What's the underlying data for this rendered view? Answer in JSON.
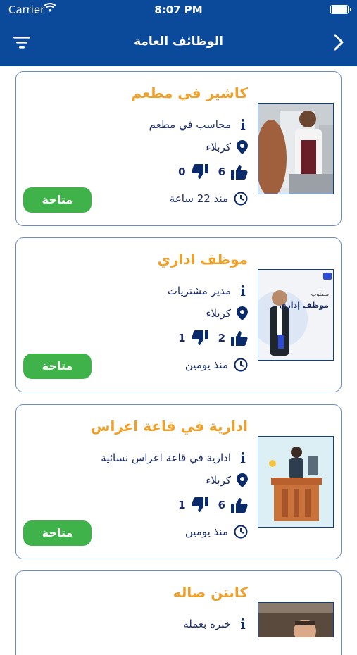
{
  "status_bar": {
    "carrier": "Carrier",
    "time": "8:07 PM"
  },
  "header": {
    "title": "الوظائف العامة"
  },
  "jobs": [
    {
      "title": "كاشير في مطعم",
      "role": "محاسب في مطعم",
      "city": "كربلاء",
      "likes": "6",
      "dislikes": "0",
      "posted": "منذ 22 ساعة",
      "status": "متاحة"
    },
    {
      "title": "موظف اداري",
      "role": "مدير مشتريات",
      "city": "كربلاء",
      "likes": "2",
      "dislikes": "1",
      "posted": "منذ يومين",
      "status": "متاحة",
      "thumb_text_top": "مطلوب",
      "thumb_text_main": "موظف إداري"
    },
    {
      "title": "ادارية في قاعة اعراس",
      "role": "ادارية في قاعة اعراس نسائية",
      "city": "كربلاء",
      "likes": "6",
      "dislikes": "1",
      "posted": "منذ يومين",
      "status": "متاحة"
    },
    {
      "title": "كابتن صاله",
      "role": "خبره بعمله"
    }
  ],
  "colors": {
    "header": "#0b4a9a",
    "title": "#eda02a",
    "button": "#3fb24a",
    "text": "#1b2b66"
  },
  "icons": [
    "filter-icon",
    "chevron-right-icon",
    "info-icon",
    "location-pin-icon",
    "thumbs-up-icon",
    "thumbs-down-icon",
    "clock-icon",
    "wifi-icon",
    "battery-icon"
  ]
}
